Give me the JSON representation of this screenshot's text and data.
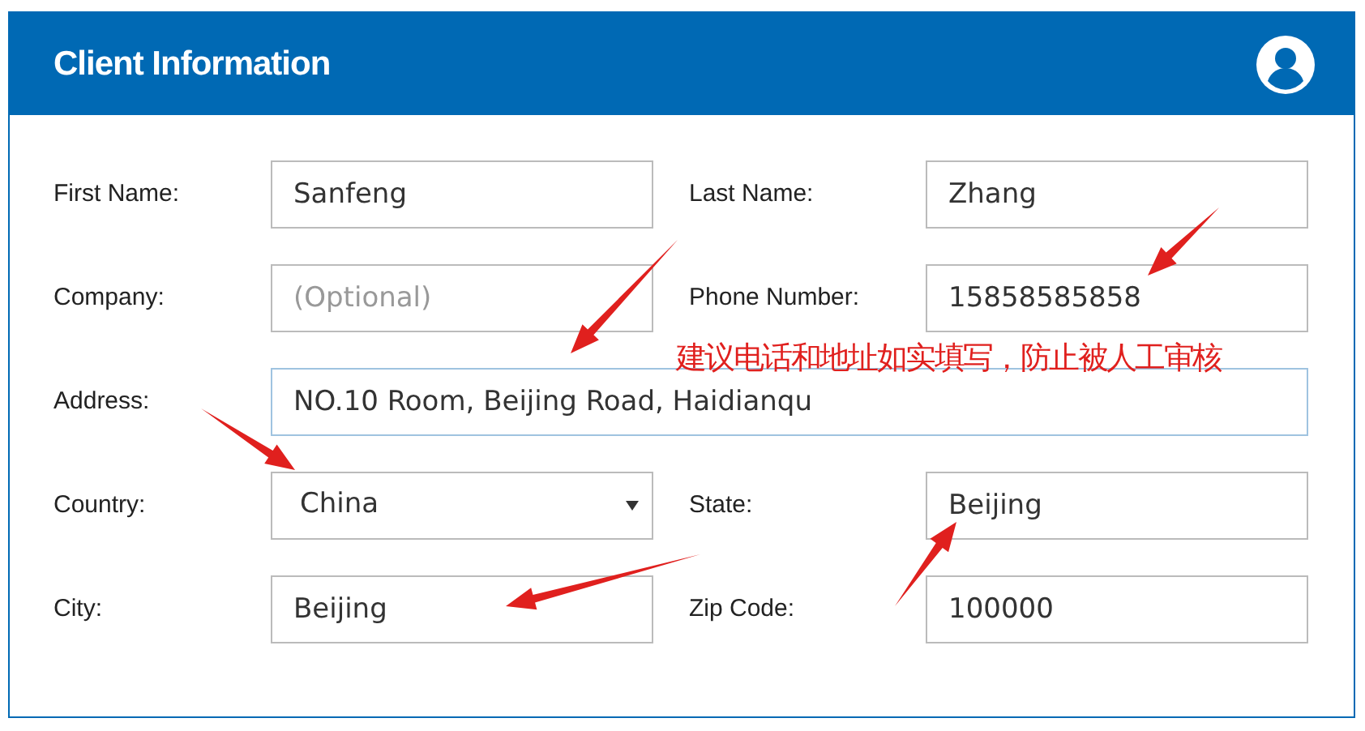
{
  "card": {
    "title": "Client Information"
  },
  "fields": [
    {
      "label": "First Name:",
      "kind": "text",
      "value": "Sanfeng"
    },
    {
      "label": "Last Name:",
      "kind": "text",
      "value": "Zhang"
    },
    {
      "label": "Company:",
      "kind": "text",
      "placeholder": "(Optional)"
    },
    {
      "label": "Phone Number:",
      "kind": "text",
      "value": "15858585858"
    },
    {
      "label": "Address:",
      "kind": "wide",
      "value": "NO.10 Room, Beijing Road, Haidianqu"
    },
    {
      "label": "Country:",
      "kind": "select",
      "value": "China"
    },
    {
      "label": "State:",
      "kind": "text",
      "value": "Beijing"
    },
    {
      "label": "City:",
      "kind": "text",
      "value": "Beijing"
    },
    {
      "label": "Zip Code:",
      "kind": "text",
      "value": "100000"
    }
  ],
  "annotation": {
    "note": "建议电话和地址如实填写，防止被人工审核"
  }
}
